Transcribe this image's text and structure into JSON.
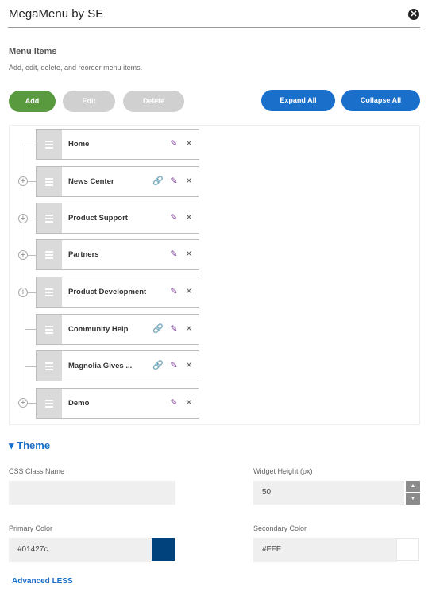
{
  "header": {
    "title": "MegaMenu by SE",
    "close_icon": "close-circle-icon"
  },
  "menu_section": {
    "title": "Menu Items",
    "description": "Add, edit, delete, and reorder menu items."
  },
  "toolbar": {
    "add_label": "Add",
    "edit_label": "Edit",
    "delete_label": "Delete",
    "expand_all_label": "Expand All",
    "collapse_all_label": "Collapse All"
  },
  "menu_items": [
    {
      "label": "Home",
      "has_link": false,
      "expandable": false
    },
    {
      "label": "News Center",
      "has_link": true,
      "expandable": true
    },
    {
      "label": "Product Support",
      "has_link": false,
      "expandable": true
    },
    {
      "label": "Partners",
      "has_link": false,
      "expandable": true
    },
    {
      "label": "Product Development",
      "has_link": false,
      "expandable": true
    },
    {
      "label": "Community Help",
      "has_link": true,
      "expandable": false
    },
    {
      "label": "Magnolia Gives ...",
      "has_link": true,
      "expandable": false
    },
    {
      "label": "Demo",
      "has_link": false,
      "expandable": true
    }
  ],
  "theme": {
    "heading": "Theme",
    "css_class_label": "CSS Class Name",
    "css_class_value": "",
    "widget_height_label": "Widget Height (px)",
    "widget_height_value": "50",
    "primary_color_label": "Primary Color",
    "primary_color_value": "#01427c",
    "secondary_color_label": "Secondary Color",
    "secondary_color_value": "#FFF",
    "advanced_link": "Advanced LESS"
  },
  "colors": {
    "accent_blue": "#1a6fcb",
    "add_green": "#5a9a3e",
    "disabled_gray": "#d0d0d0",
    "edit_purple": "#7b3a96"
  }
}
